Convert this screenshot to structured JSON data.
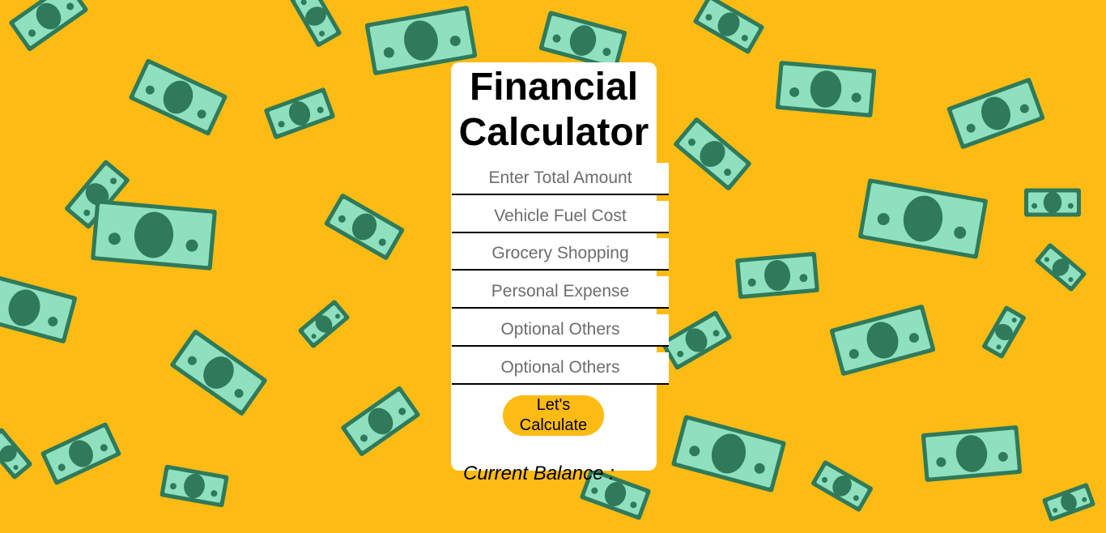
{
  "app": {
    "title": "Financial Calculator"
  },
  "form": {
    "fields": [
      {
        "placeholder": "Enter Total Amount",
        "value": ""
      },
      {
        "placeholder": "Vehicle Fuel Cost",
        "value": ""
      },
      {
        "placeholder": "Grocery Shopping",
        "value": ""
      },
      {
        "placeholder": "Personal Expense",
        "value": ""
      },
      {
        "placeholder": "Optional Others",
        "value": ""
      },
      {
        "placeholder": "Optional Others",
        "value": ""
      }
    ],
    "calculate_label": "Let's Calculate"
  },
  "result": {
    "balance_label": "Current Balance :"
  },
  "theme": {
    "background": "#fdbb13",
    "card": "#ffffff",
    "note_dark": "#2f7a5a",
    "note_light": "#8fe0bf"
  },
  "background_icon": "money-bills"
}
